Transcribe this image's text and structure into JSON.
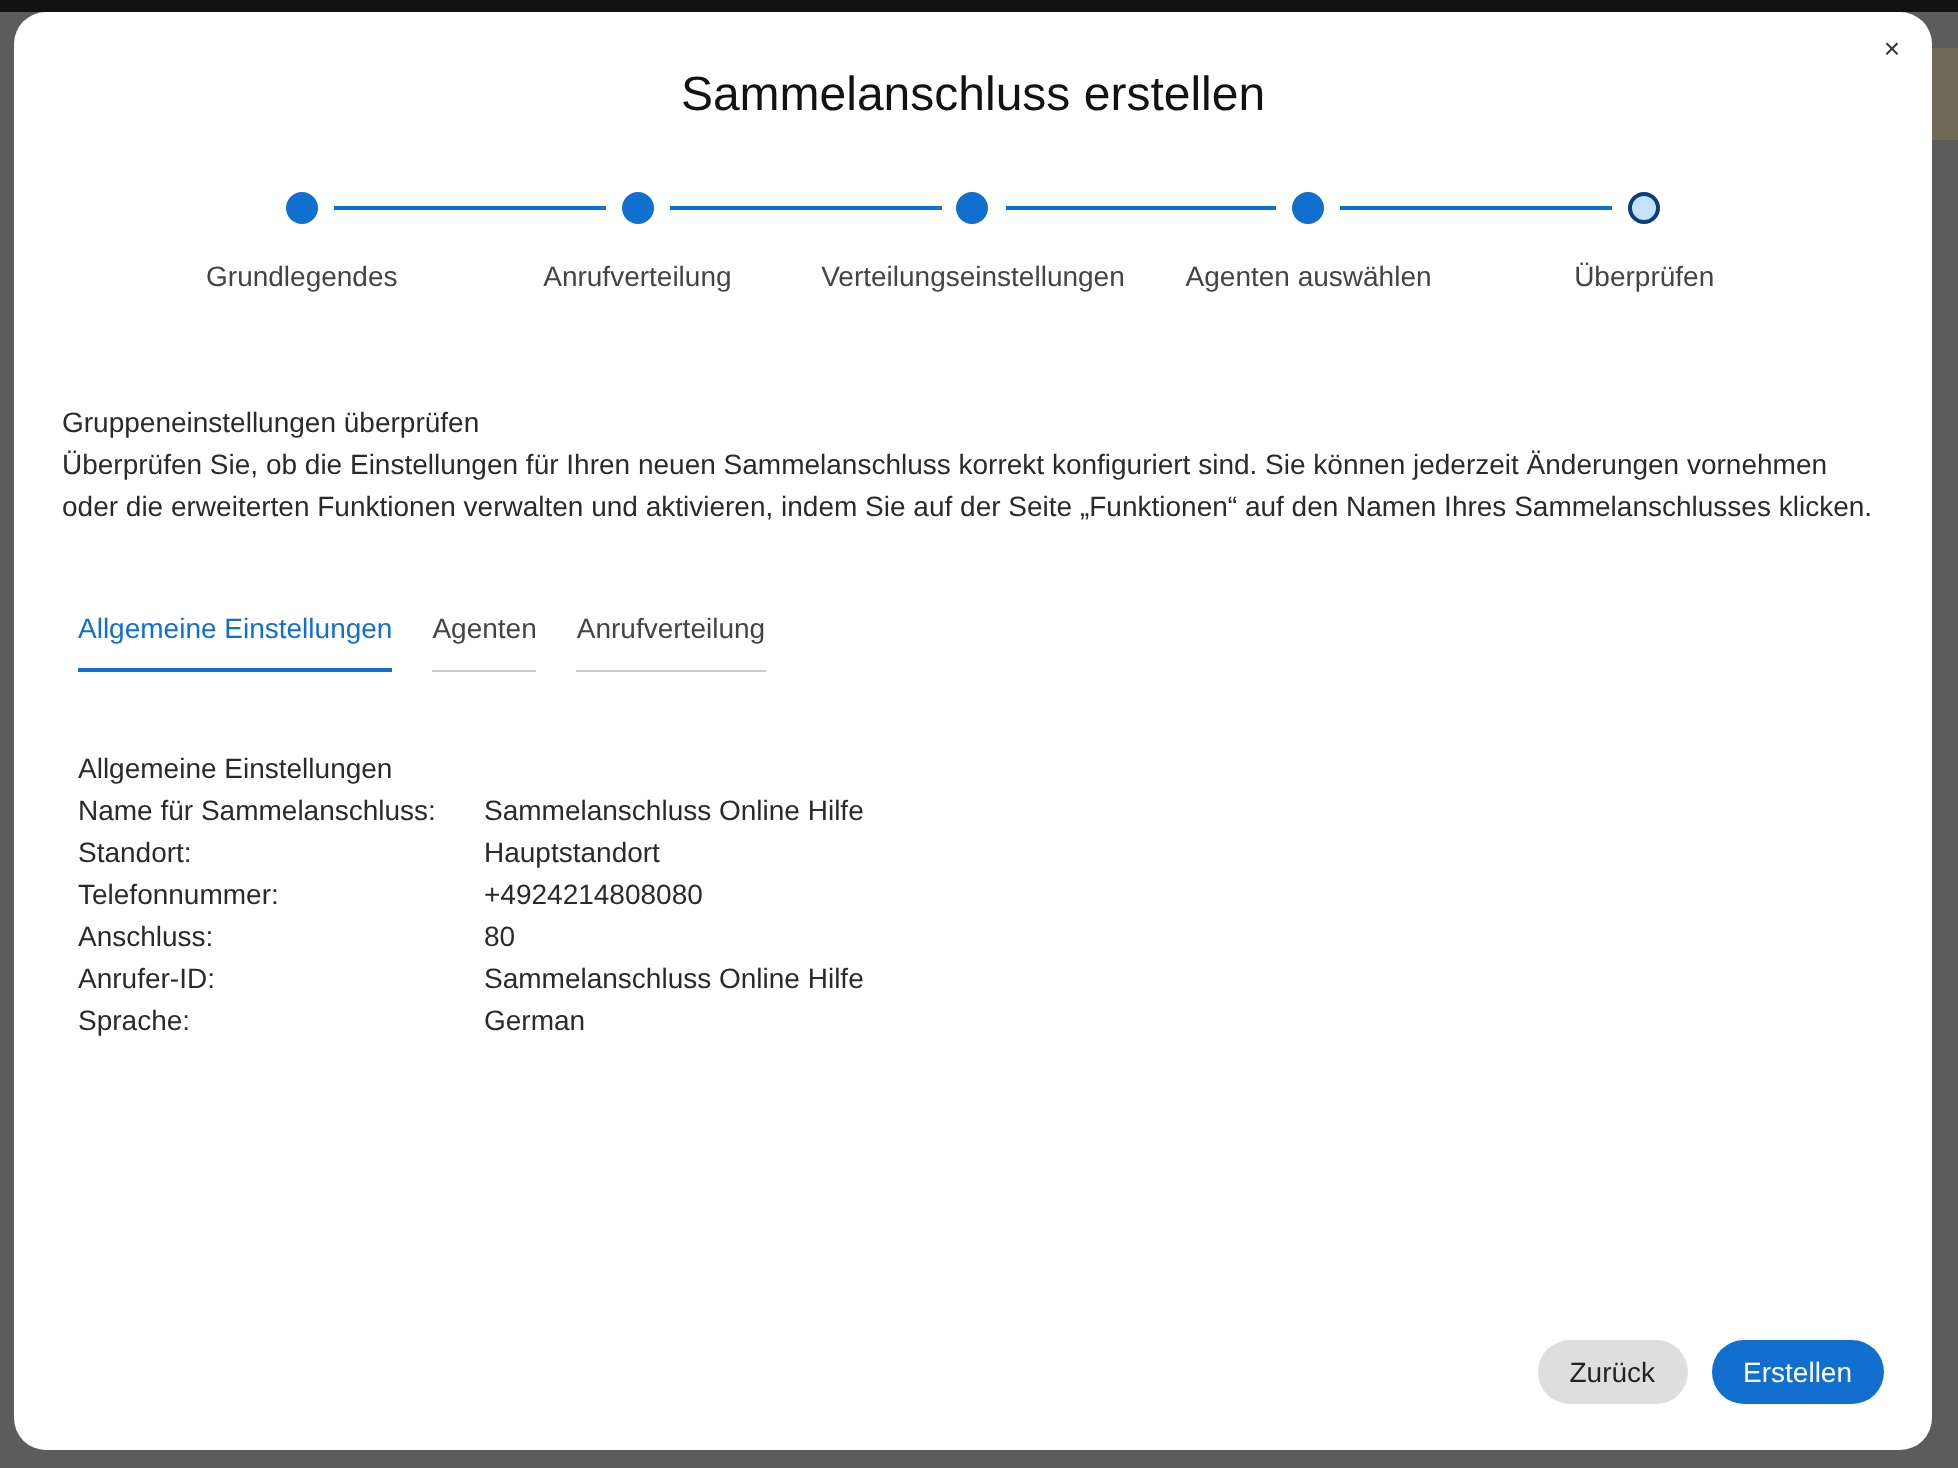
{
  "dialog": {
    "title": "Sammelanschluss erstellen",
    "close": "×"
  },
  "steps": [
    {
      "label": "Grundlegendes",
      "selected": false
    },
    {
      "label": "Anrufverteilung",
      "selected": false
    },
    {
      "label": "Verteilungseinstellungen",
      "selected": false
    },
    {
      "label": "Agenten auswählen",
      "selected": false
    },
    {
      "label": "Überprüfen",
      "selected": true
    }
  ],
  "intro": {
    "heading": "Gruppeneinstellungen überprüfen",
    "text": "Überprüfen Sie, ob die Einstellungen für Ihren neuen Sammelanschluss korrekt konfiguriert sind. Sie können jederzeit Änderungen vornehmen oder die erweiterten Funktionen verwalten und aktivieren, indem Sie auf der Seite „Funktionen“ auf den Namen Ihres Sammelanschlusses klicken."
  },
  "tabs": [
    {
      "label": "Allgemeine Einstellungen",
      "selected": true
    },
    {
      "label": "Agenten",
      "selected": false
    },
    {
      "label": "Anrufverteilung",
      "selected": false
    }
  ],
  "section_title": "Allgemeine Einstellungen",
  "settings": [
    {
      "label": "Name für Sammelanschluss:",
      "value": "Sammelanschluss Online Hilfe"
    },
    {
      "label": "Standort:",
      "value": "Hauptstandort"
    },
    {
      "label": "Telefonnummer:",
      "value": "+4924214808080"
    },
    {
      "label": "Anschluss:",
      "value": "80"
    },
    {
      "label": "Anrufer-ID:",
      "value": "Sammelanschluss Online Hilfe"
    },
    {
      "label": "Sprache:",
      "value": "German"
    }
  ],
  "buttons": [
    {
      "label": "Zurück",
      "kind": "secondary"
    },
    {
      "label": "Erstellen",
      "kind": "primary"
    }
  ]
}
